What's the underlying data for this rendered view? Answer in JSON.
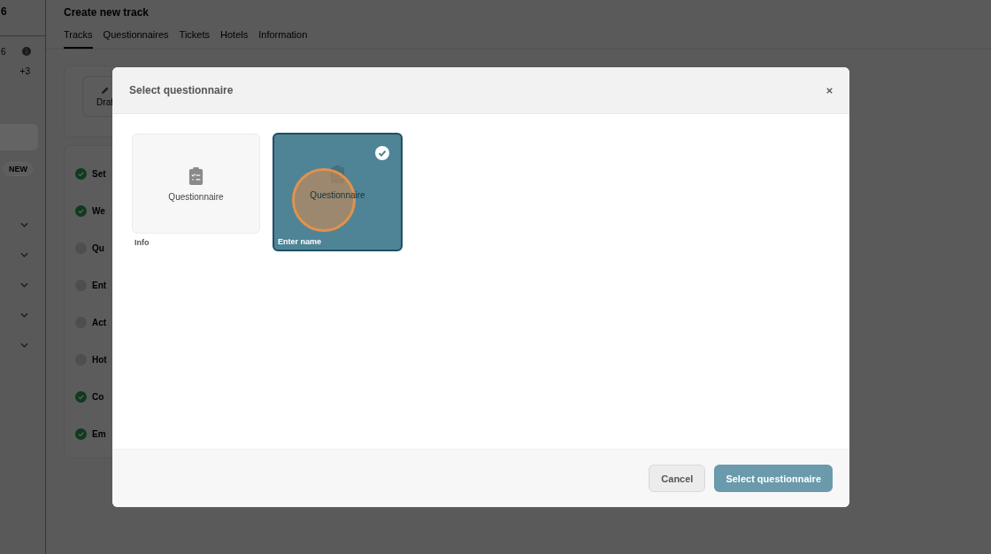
{
  "sidebar": {
    "top_text": "6",
    "count": "6",
    "extra_count": "+3",
    "badge": "NEW",
    "groups": [
      {
        "expanded": false
      },
      {
        "expanded": false
      },
      {
        "expanded": false
      },
      {
        "expanded": false
      },
      {
        "expanded": false
      }
    ]
  },
  "page": {
    "title": "Create new track",
    "tabs": [
      {
        "label": "Tracks",
        "selected": true
      },
      {
        "label": "Questionnaires",
        "selected": false
      },
      {
        "label": "Tickets",
        "selected": false
      },
      {
        "label": "Hotels",
        "selected": false
      },
      {
        "label": "Information",
        "selected": false
      }
    ],
    "status": "Draf",
    "steps": [
      {
        "label": "Set",
        "done": true
      },
      {
        "label": "We",
        "done": true
      },
      {
        "label": "Qu",
        "done": false
      },
      {
        "label": "Ent",
        "done": false
      },
      {
        "label": "Act",
        "done": false
      },
      {
        "label": "Hot",
        "done": false
      },
      {
        "label": "Co",
        "done": true
      },
      {
        "label": "Em",
        "done": true
      }
    ]
  },
  "dialog": {
    "title": "Select questionnaire",
    "options": [
      {
        "title": "Questionnaire",
        "label": "Info",
        "selected": false
      },
      {
        "title": "Questionnaire",
        "label": "Enter name",
        "selected": true
      }
    ],
    "buttons": [
      {
        "label": "Cancel",
        "kind": "secondary"
      },
      {
        "label": "Select questionnaire",
        "kind": "primary"
      }
    ]
  }
}
